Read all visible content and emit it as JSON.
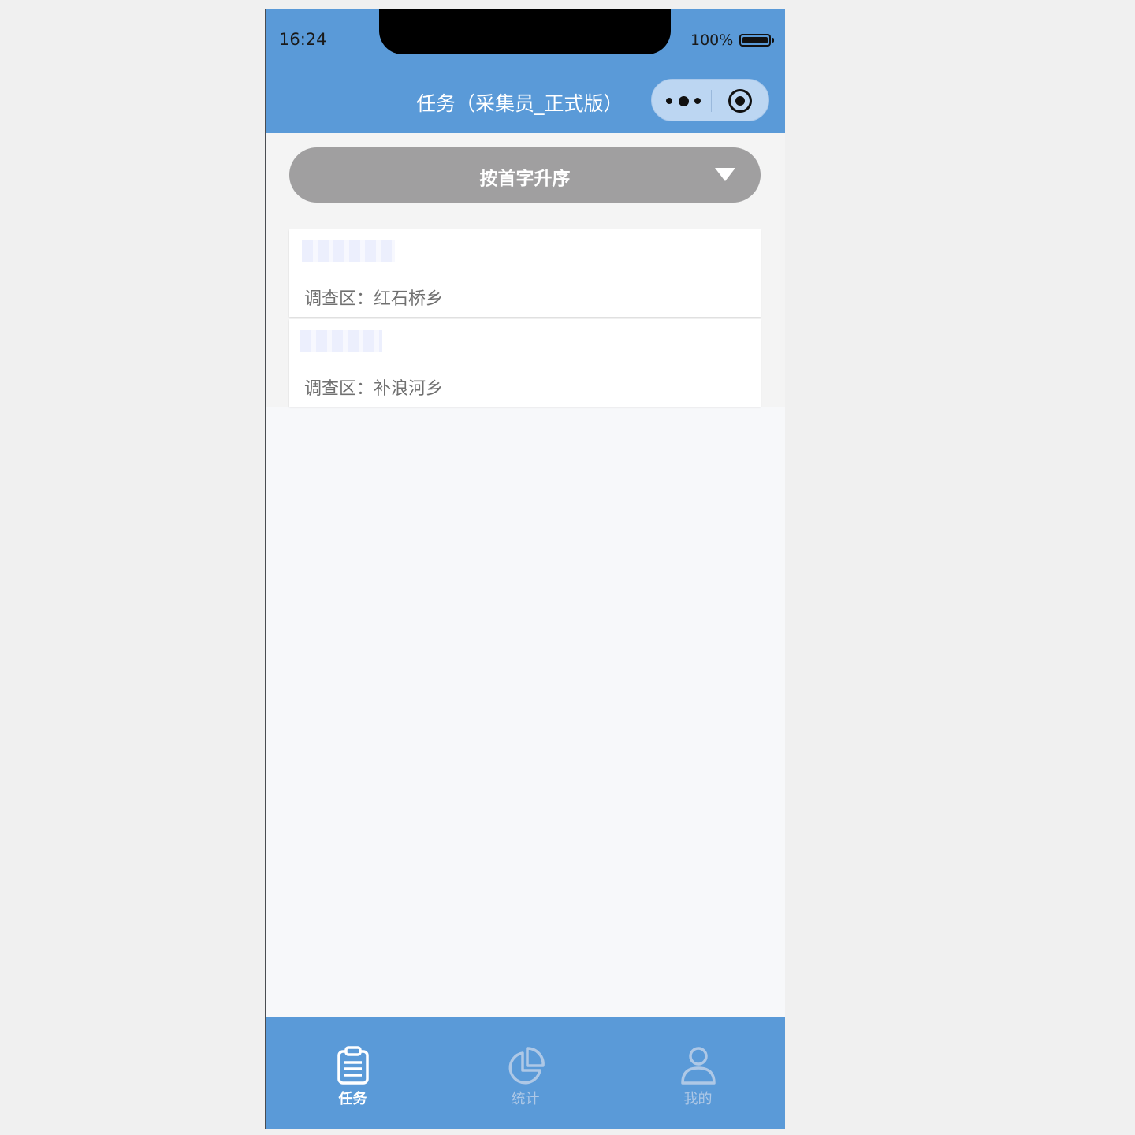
{
  "status_bar": {
    "time": "16:24",
    "battery": "100%"
  },
  "nav": {
    "title": "任务（采集员_正式版）",
    "more_icon": "more-dots-icon",
    "close_icon": "target-circle-icon"
  },
  "sort": {
    "label": "按首字升序",
    "icon": "triangle-down-icon"
  },
  "tasks": [
    {
      "survey_area": "调查区：红石桥乡"
    },
    {
      "survey_area": "调查区：补浪河乡"
    }
  ],
  "tabs": [
    {
      "label": "任务",
      "icon": "clipboard-icon",
      "active": true
    },
    {
      "label": "统计",
      "icon": "pie-chart-icon",
      "active": false
    },
    {
      "label": "我的",
      "icon": "user-icon",
      "active": false
    }
  ],
  "colors": {
    "primary": "#5a9ad8",
    "sort_button": "#a09fa0",
    "tab_inactive": "#aec8e6",
    "text_secondary": "#707070"
  }
}
